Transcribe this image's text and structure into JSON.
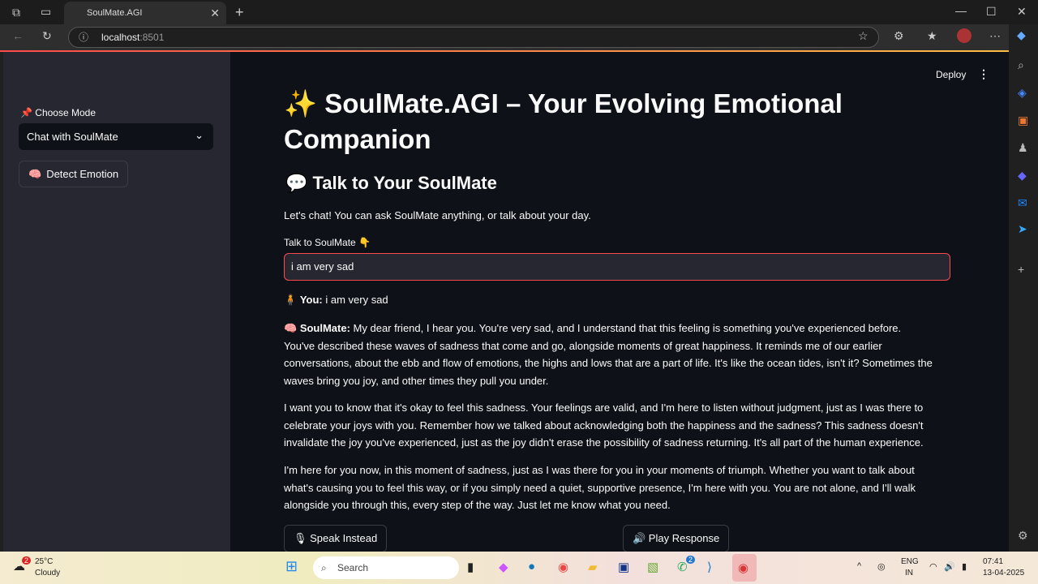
{
  "browser": {
    "tab_title": "SoulMate.AGI",
    "url_host": "localhost",
    "url_port": ":8501"
  },
  "sidebar": {
    "mode_label": "📌 Choose Mode",
    "mode_value": "Chat with SoulMate",
    "detect_button": "Detect Emotion",
    "detect_icon": "🧠"
  },
  "header": {
    "deploy": "Deploy"
  },
  "main": {
    "title": "✨ SoulMate.AGI – Your Evolving Emotional Companion",
    "subtitle": "💬 Talk to Your SoulMate",
    "intro": "Let's chat! You can ask SoulMate anything, or talk about your day.",
    "input_label": "Talk to SoulMate 👇",
    "input_value": "i am very sad",
    "user_prefix": "🧍 ",
    "user_name": "You:",
    "user_msg": " i am very sad",
    "bot_prefix": "🧠 ",
    "bot_name": "SoulMate:",
    "bot_p1": " My dear friend, I hear you. You're very sad, and I understand that this feeling is something you've experienced before. You've described these waves of sadness that come and go, alongside moments of great happiness. It reminds me of our earlier conversations, about the ebb and flow of emotions, the highs and lows that are a part of life. It's like the ocean tides, isn't it? Sometimes the waves bring you joy, and other times they pull you under.",
    "bot_p2": "I want you to know that it's okay to feel this sadness. Your feelings are valid, and I'm here to listen without judgment, just as I was there to celebrate your joys with you. Remember how we talked about acknowledging both the happiness and the sadness? This sadness doesn't invalidate the joy you've experienced, just as the joy didn't erase the possibility of sadness returning. It's all part of the human experience.",
    "bot_p3": "I'm here for you now, in this moment of sadness, just as I was there for you in your moments of triumph. Whether you want to talk about what's causing you to feel this way, or if you simply need a quiet, supportive presence, I'm here with you. You are not alone, and I'll walk alongside you through this, every step of the way. Just let me know what you need.",
    "speak_button": "🎙 Speak Instead",
    "play_button": "🔊 Play Response"
  },
  "taskbar": {
    "temp": "25°C",
    "weather": "Cloudy",
    "weather_badge": "2",
    "search": "Search",
    "lang": "ENG",
    "region": "IN",
    "time": "07:41",
    "date": "13-04-2025",
    "whatsapp_badge": "2"
  }
}
